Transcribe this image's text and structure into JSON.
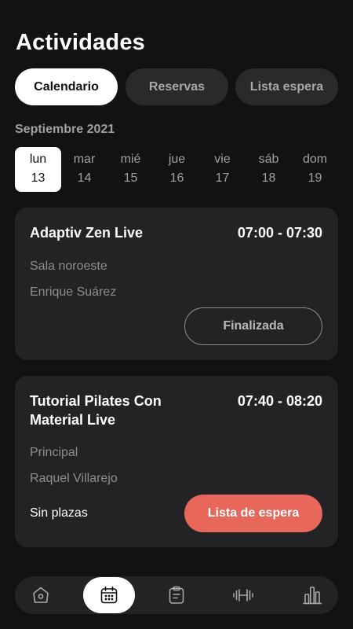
{
  "header": {
    "title": "Actividades"
  },
  "tabs": [
    {
      "label": "Calendario",
      "active": true
    },
    {
      "label": "Reservas",
      "active": false
    },
    {
      "label": "Lista espera",
      "active": false
    }
  ],
  "calendar": {
    "month": "Septiembre 2021",
    "days": [
      {
        "name": "lun",
        "num": "13",
        "active": true
      },
      {
        "name": "mar",
        "num": "14",
        "active": false
      },
      {
        "name": "mié",
        "num": "15",
        "active": false
      },
      {
        "name": "jue",
        "num": "16",
        "active": false
      },
      {
        "name": "vie",
        "num": "17",
        "active": false
      },
      {
        "name": "sáb",
        "num": "18",
        "active": false
      },
      {
        "name": "dom",
        "num": "19",
        "active": false
      }
    ]
  },
  "activities": [
    {
      "name": "Adaptiv Zen Live",
      "time": "07:00 - 07:30",
      "room": "Sala noroeste",
      "instructor": "Enrique Suárez",
      "status": "",
      "button": "Finalizada"
    },
    {
      "name": "Tutorial Pilates Con Material Live",
      "time": "07:40 - 08:20",
      "room": "Principal",
      "instructor": "Raquel Villarejo",
      "status": "Sin plazas",
      "button": "Lista de espera"
    }
  ],
  "nav": {
    "items": [
      {
        "icon": "home-icon",
        "active": false
      },
      {
        "icon": "calendar-icon",
        "active": true
      },
      {
        "icon": "clipboard-icon",
        "active": false
      },
      {
        "icon": "dumbbell-icon",
        "active": false
      },
      {
        "icon": "bar-chart-icon",
        "active": false
      }
    ]
  },
  "colors": {
    "background": "#121212",
    "card": "#232325",
    "accent": "#e8675b",
    "active": "#ffffff"
  }
}
